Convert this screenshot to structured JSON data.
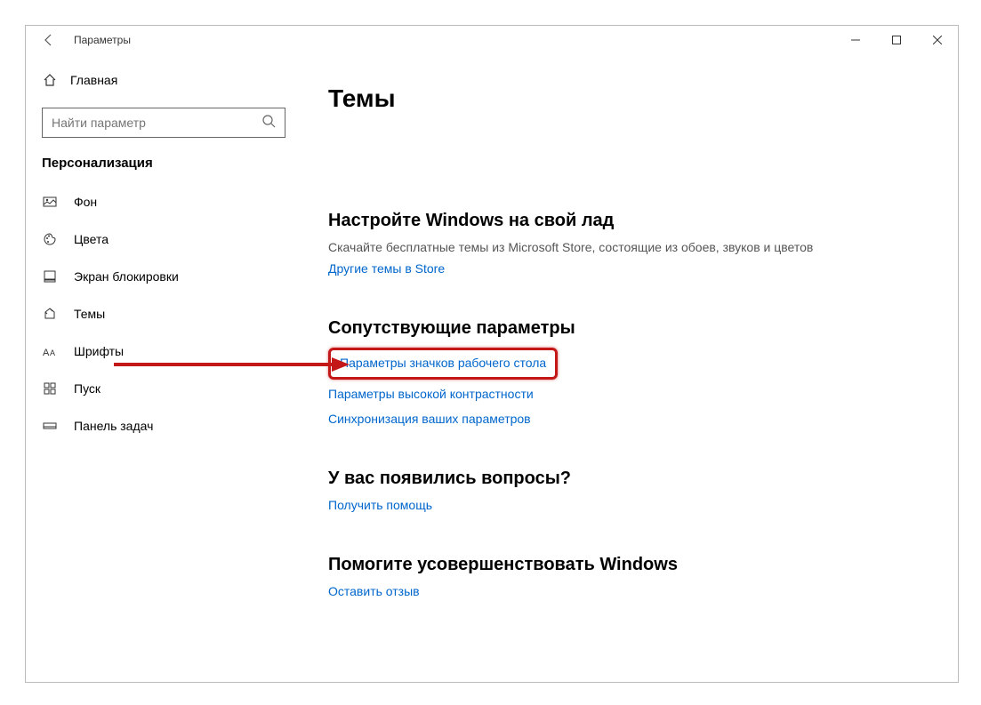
{
  "titlebar": {
    "title": "Параметры"
  },
  "sidebar": {
    "home": "Главная",
    "search_placeholder": "Найти параметр",
    "section": "Персонализация",
    "items": [
      {
        "label": "Фон",
        "icon": "image-icon"
      },
      {
        "label": "Цвета",
        "icon": "palette-icon"
      },
      {
        "label": "Экран блокировки",
        "icon": "lockscreen-icon"
      },
      {
        "label": "Темы",
        "icon": "themes-icon"
      },
      {
        "label": "Шрифты",
        "icon": "fonts-icon"
      },
      {
        "label": "Пуск",
        "icon": "start-icon"
      },
      {
        "label": "Панель задач",
        "icon": "taskbar-icon"
      }
    ]
  },
  "content": {
    "title": "Темы",
    "customize": {
      "heading": "Настройте Windows на свой лад",
      "subtitle": "Скачайте бесплатные темы из Microsoft Store, состоящие из обоев, звуков и цветов",
      "link": "Другие темы в Store"
    },
    "related": {
      "heading": "Сопутствующие параметры",
      "links": [
        "Параметры значков рабочего стола",
        "Параметры высокой контрастности",
        "Синхронизация ваших параметров"
      ]
    },
    "questions": {
      "heading": "У вас появились вопросы?",
      "link": "Получить помощь"
    },
    "feedback": {
      "heading": "Помогите усовершенствовать Windows",
      "link": "Оставить отзыв"
    }
  }
}
